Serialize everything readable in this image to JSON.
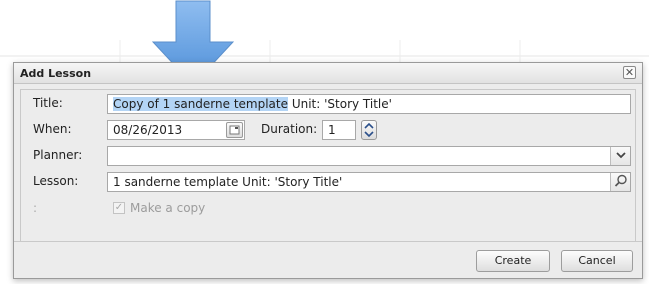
{
  "dialog": {
    "title": "Add Lesson",
    "close_glyph": "✕"
  },
  "form": {
    "title_label": "Title:",
    "title_selected": "Copy of 1 sanderne template",
    "title_rest": "Unit:  'Story Title'",
    "when_label": "When:",
    "when_value": "08/26/2013",
    "duration_label": "Duration:",
    "duration_value": "1",
    "planner_label": "Planner:",
    "planner_value": "",
    "lesson_label": "Lesson:",
    "lesson_value": "1 sanderne template  Unit:  'Story Title'",
    "copy_row_label": ":",
    "make_copy_label": "Make a copy",
    "make_copy_checked": true
  },
  "buttons": {
    "create": "Create",
    "cancel": "Cancel"
  },
  "colors": {
    "arrow": "#6aa3e0",
    "selection": "#b3d4f5"
  }
}
